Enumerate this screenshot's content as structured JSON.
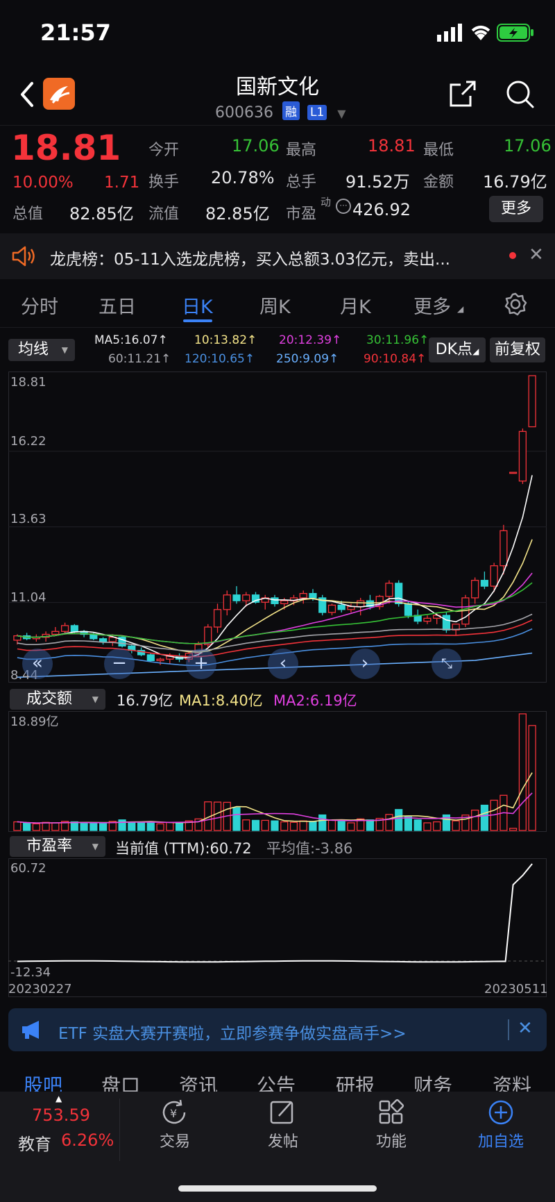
{
  "status": {
    "time": "21:57"
  },
  "header": {
    "title": "国新文化",
    "code": "600636",
    "tag1": "融",
    "tag2": "L1"
  },
  "quote": {
    "price": "18.81",
    "pct": "10.00%",
    "chg": "1.71",
    "open_label": "今开",
    "open": "17.06",
    "high_label": "最高",
    "high": "18.81",
    "low_label": "最低",
    "low": "17.06",
    "turnover_label": "换手",
    "turnover": "20.78%",
    "vol_label": "总手",
    "vol": "91.52万",
    "amount_label": "金额",
    "amount": "16.79亿",
    "mktcap_label": "总值",
    "mktcap": "82.85亿",
    "float_label": "流值",
    "float": "82.85亿",
    "pe_label": "市盈",
    "pe_sup": "动",
    "pe": "426.92",
    "more": "更多"
  },
  "notice": {
    "text": "龙虎榜：05-11入选龙虎榜，买入总额3.03亿元，卖出..."
  },
  "tabs": [
    "分时",
    "五日",
    "日K",
    "周K",
    "月K",
    "更多"
  ],
  "active_tab": "日K",
  "ma": {
    "selector": "均线",
    "ma5": "MA5:16.07↑",
    "ma10": "10:13.82↑",
    "ma20": "20:12.39↑",
    "ma30": "30:11.96↑",
    "ma60": "60:11.21↑",
    "ma120": "120:10.65↑",
    "ma250": "250:9.09↑",
    "ma90": "90:10.84↑",
    "dk": "DK点",
    "adjust": "前复权"
  },
  "kline": {
    "y1": "18.81",
    "y2": "16.22",
    "y3": "13.63",
    "y4": "11.04",
    "y5": "8.44"
  },
  "volume": {
    "selector": "成交额",
    "value": "16.79亿",
    "ma1": "MA1:8.40亿",
    "ma2": "MA2:6.19亿",
    "ymax": "18.89亿"
  },
  "pe_panel": {
    "selector": "市盈率",
    "current": "当前值 (TTM):60.72",
    "avg": "平均值:-3.86",
    "ymax": "60.72",
    "ymin": "-12.34",
    "start": "20230227",
    "end": "20230511"
  },
  "banner": {
    "text": "ETF 实盘大赛开赛啦，立即参赛争做实盘高手>>"
  },
  "subtabs": [
    "股吧",
    "盘口",
    "资讯",
    "公告",
    "研报",
    "财务",
    "资料"
  ],
  "bottom": {
    "index_value": "753.59",
    "index_name": "教育",
    "index_pct": "6.26%",
    "trade": "交易",
    "post": "发帖",
    "func": "功能",
    "add": "加自选"
  },
  "colors": {
    "up": "#f4333a",
    "down": "#2ed3d3",
    "accent": "#3b82f6"
  },
  "chart_data": {
    "type": "candlestick",
    "candles": [
      [
        9.75,
        9.6,
        9.95,
        9.9
      ],
      [
        9.9,
        9.75,
        10.0,
        9.8
      ],
      [
        9.8,
        9.7,
        9.95,
        9.85
      ],
      [
        9.85,
        9.7,
        10.05,
        9.95
      ],
      [
        9.95,
        9.9,
        10.2,
        10.05
      ],
      [
        10.05,
        10.0,
        10.35,
        10.25
      ],
      [
        10.25,
        10.0,
        10.3,
        10.05
      ],
      [
        10.05,
        9.85,
        10.1,
        9.95
      ],
      [
        9.95,
        9.75,
        10.0,
        9.8
      ],
      [
        9.8,
        9.6,
        9.85,
        9.7
      ],
      [
        9.7,
        9.55,
        9.95,
        9.85
      ],
      [
        9.85,
        9.5,
        9.9,
        9.55
      ],
      [
        9.55,
        9.3,
        9.6,
        9.4
      ],
      [
        9.4,
        9.2,
        9.5,
        9.25
      ],
      [
        9.25,
        9.0,
        9.3,
        9.05
      ],
      [
        9.05,
        8.9,
        9.15,
        9.1
      ],
      [
        9.1,
        8.95,
        9.3,
        9.2
      ],
      [
        9.2,
        9.0,
        9.3,
        9.1
      ],
      [
        9.1,
        9.0,
        9.4,
        9.3
      ],
      [
        9.3,
        9.2,
        9.7,
        9.6
      ],
      [
        9.6,
        9.5,
        10.3,
        10.2
      ],
      [
        10.2,
        10.0,
        11.0,
        10.8
      ],
      [
        10.8,
        10.6,
        11.45,
        11.3
      ],
      [
        11.3,
        11.0,
        11.6,
        11.1
      ],
      [
        11.1,
        10.9,
        11.4,
        11.3
      ],
      [
        11.3,
        11.0,
        11.4,
        11.05
      ],
      [
        11.05,
        10.8,
        11.3,
        11.2
      ],
      [
        11.2,
        10.9,
        11.3,
        11.0
      ],
      [
        11.0,
        10.8,
        11.2,
        11.1
      ],
      [
        11.1,
        10.95,
        11.3,
        11.2
      ],
      [
        11.2,
        11.0,
        11.45,
        11.35
      ],
      [
        11.35,
        11.1,
        11.5,
        11.2
      ],
      [
        11.2,
        10.6,
        11.3,
        10.7
      ],
      [
        10.7,
        10.6,
        11.0,
        10.95
      ],
      [
        10.95,
        10.7,
        11.1,
        10.8
      ],
      [
        10.8,
        10.7,
        11.0,
        10.9
      ],
      [
        10.9,
        10.6,
        11.2,
        11.1
      ],
      [
        11.1,
        10.8,
        11.3,
        10.9
      ],
      [
        10.9,
        10.8,
        11.3,
        11.25
      ],
      [
        11.25,
        11.0,
        11.8,
        11.7
      ],
      [
        11.7,
        10.9,
        11.8,
        11.0
      ],
      [
        11.0,
        10.5,
        11.1,
        10.6
      ],
      [
        10.6,
        10.3,
        10.8,
        10.4
      ],
      [
        10.4,
        10.3,
        10.6,
        10.5
      ],
      [
        10.5,
        10.3,
        10.7,
        10.6
      ],
      [
        10.6,
        10.0,
        10.7,
        10.1
      ],
      [
        10.1,
        9.9,
        10.3,
        10.3
      ],
      [
        10.3,
        10.2,
        11.3,
        11.2
      ],
      [
        11.2,
        11.0,
        11.9,
        11.8
      ],
      [
        11.8,
        11.5,
        12.1,
        11.6
      ],
      [
        11.6,
        11.4,
        12.4,
        12.3
      ],
      [
        12.3,
        12.0,
        13.7,
        13.5
      ],
      [
        15.5,
        15.5,
        15.5,
        15.5
      ],
      [
        15.2,
        15.1,
        17.0,
        16.9
      ],
      [
        17.06,
        17.06,
        18.81,
        18.81
      ]
    ],
    "ylim": [
      8.44,
      18.81
    ],
    "y_ticks": [
      "18.81",
      "16.22",
      "13.63",
      "11.04",
      "8.44"
    ],
    "volume_ylim": [
      0,
      18.89
    ],
    "pe_ylim": [
      -12.34,
      60.72
    ],
    "x_start": "20230227",
    "x_end": "20230511"
  }
}
